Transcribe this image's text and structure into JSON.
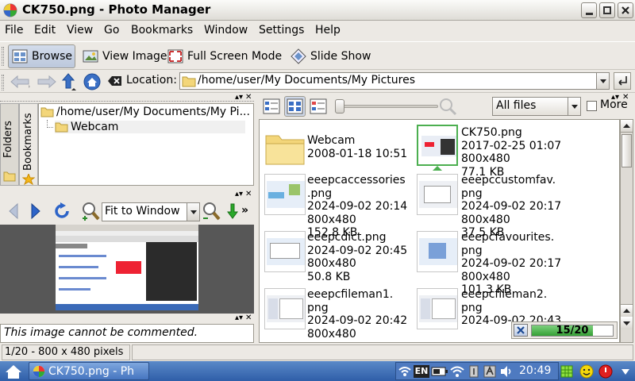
{
  "window": {
    "title": "CK750.png - Photo Manager"
  },
  "menu": [
    {
      "label": "File"
    },
    {
      "label": "Edit"
    },
    {
      "label": "View"
    },
    {
      "label": "Go"
    },
    {
      "label": "Bookmarks"
    },
    {
      "label": "Window"
    },
    {
      "label": "Settings"
    },
    {
      "label": "Help"
    }
  ],
  "toolbar": {
    "browse": "Browse",
    "view_image": "View Image",
    "full_screen": "Full Screen Mode",
    "slide_show": "Slide Show"
  },
  "location": {
    "label": "Location:",
    "value": "/home/user/My Documents/My Pictures"
  },
  "sidebar": {
    "tabs": [
      {
        "label": "Folders"
      },
      {
        "label": "Bookmarks"
      }
    ],
    "tree": [
      {
        "label": "/home/user/My Documents/My Pi..."
      },
      {
        "label": "Webcam"
      }
    ]
  },
  "viewer": {
    "zoom": "Fit to Window"
  },
  "comment": {
    "placeholder": "This image cannot be commented."
  },
  "browser": {
    "filter": "All files",
    "more_label": "More",
    "items": [
      {
        "name": "Webcam",
        "date": "2008-01-18 10:51",
        "size": "",
        "bytes": "",
        "kind": "folder"
      },
      {
        "name": "CK750.png",
        "date": "2017-02-25 01:07",
        "size": "800x480",
        "bytes": "77.1 KB",
        "kind": "image"
      },
      {
        "name": "eeepcaccessories",
        "name2": ".png",
        "date": "2024-09-02 20:14",
        "size": "800x480",
        "bytes": "152.8 KB",
        "kind": "image"
      },
      {
        "name": "eeepccustomfav.",
        "name2": "png",
        "date": "2024-09-02 20:17",
        "size": "800x480",
        "bytes": "37.5 KB",
        "kind": "image"
      },
      {
        "name": "eeepcdict.png",
        "date": "2024-09-02 20:45",
        "size": "800x480",
        "bytes": "50.8 KB",
        "kind": "image"
      },
      {
        "name": "eeepcfavourites.",
        "name2": "png",
        "date": "2024-09-02 20:17",
        "size": "800x480",
        "bytes": "101.3 KB",
        "kind": "image"
      },
      {
        "name": "eeepcfileman1.",
        "name2": "png",
        "date": "2024-09-02 20:42",
        "size": "800x480",
        "bytes": "",
        "kind": "image"
      },
      {
        "name": "eeepcfileman2.",
        "name2": "png",
        "date": "2024-09-02 20:43",
        "size": "",
        "bytes": "",
        "kind": "image"
      }
    ],
    "progress": {
      "text": "15/20",
      "fraction": 0.75
    }
  },
  "status": {
    "text": "1/20 - 800 x 480 pixels"
  },
  "taskbar": {
    "task": "CK750.png - Ph",
    "lang": "EN",
    "clock": "20:49"
  },
  "colors": {
    "accent": "#3a6fc4",
    "taskbar": "#3b68b0",
    "progress": "#3aa43a",
    "folder": "#f3d67a"
  }
}
